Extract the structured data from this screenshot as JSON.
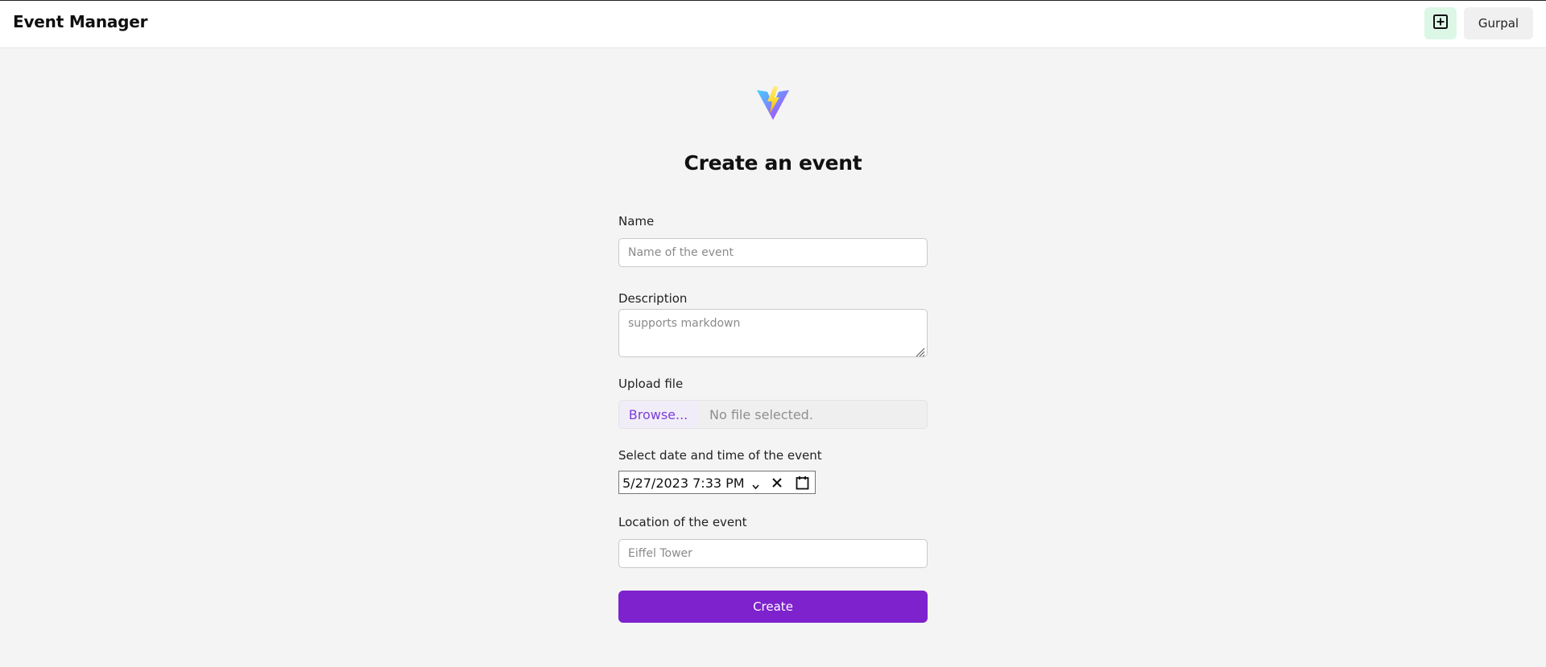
{
  "header": {
    "title": "Event Manager",
    "new_event_icon": "plus-square-icon",
    "user_label": "Gurpal"
  },
  "brand": {
    "logo_icon": "vite-logo-icon"
  },
  "form": {
    "heading": "Create an event",
    "name": {
      "label": "Name",
      "placeholder": "Name of the event",
      "value": ""
    },
    "description": {
      "label": "Description",
      "placeholder": "supports markdown",
      "value": ""
    },
    "upload": {
      "label": "Upload file",
      "browse_label": "Browse...",
      "status": "No file selected."
    },
    "datetime": {
      "label": "Select date and time of the event",
      "value": "5/27/2023 7:33 PM",
      "clear_icon": "close-icon",
      "calendar_icon": "calendar-icon"
    },
    "location": {
      "label": "Location of the event",
      "placeholder": "Eiffel Tower",
      "value": ""
    },
    "submit_label": "Create"
  },
  "colors": {
    "accent": "#7e22ce",
    "new_button_bg": "#dcf7e6",
    "page_bg": "#f4f4f4"
  }
}
